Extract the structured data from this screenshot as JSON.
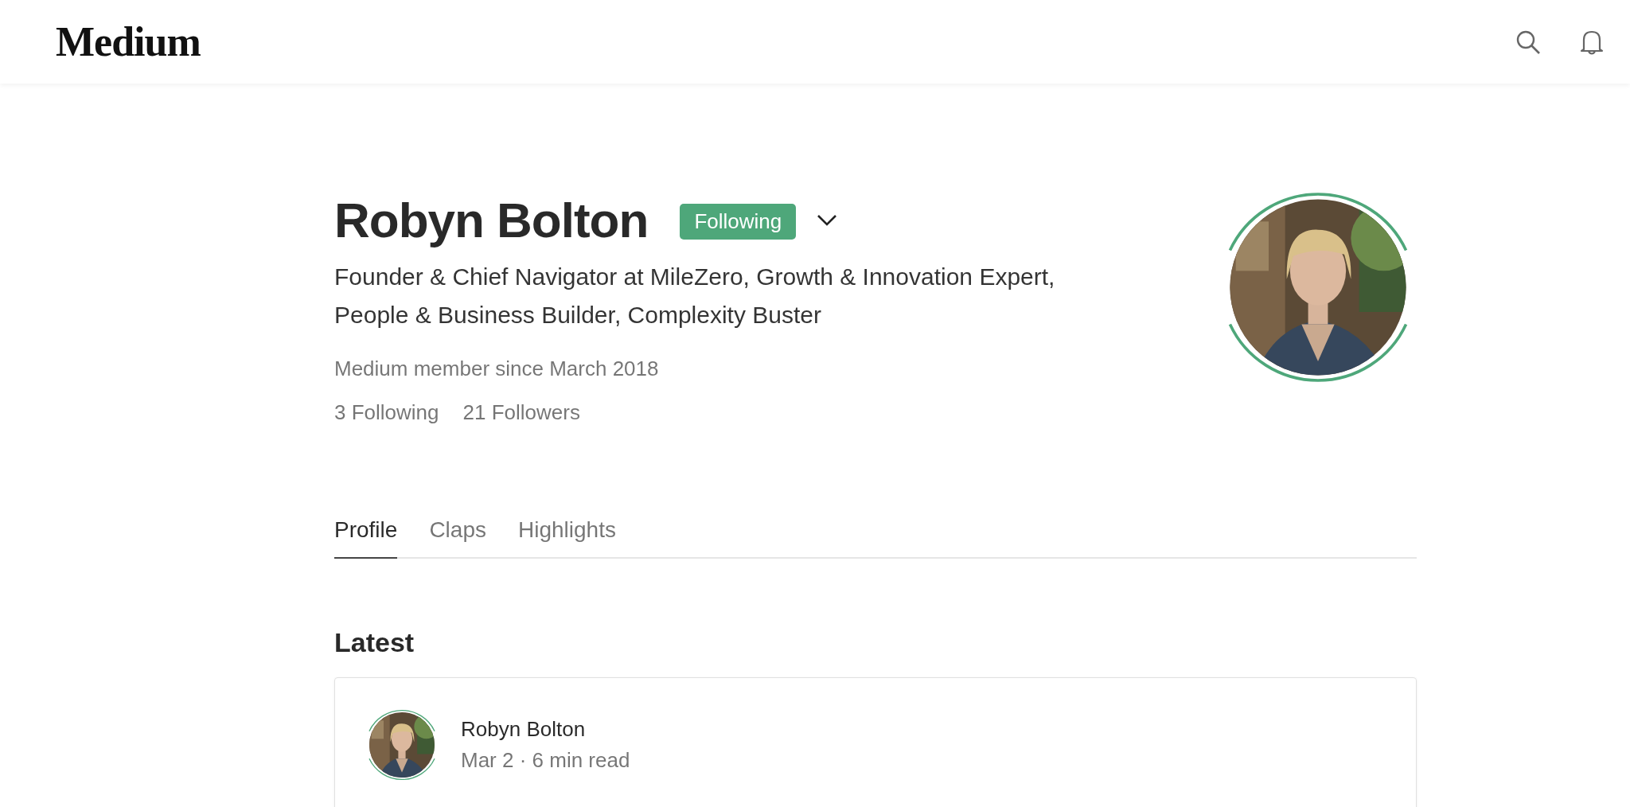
{
  "header": {
    "logo": "Medium"
  },
  "profile": {
    "name": "Robyn Bolton",
    "follow_button": "Following",
    "bio": "Founder & Chief Navigator at MileZero, Growth & Innovation Expert, People & Business Builder, Complexity Buster",
    "member_since": "Medium member since March 2018",
    "stats": [
      "3 Following",
      "21 Followers"
    ]
  },
  "tabs": [
    {
      "label": "Profile",
      "selected": true
    },
    {
      "label": "Claps",
      "selected": false
    },
    {
      "label": "Highlights",
      "selected": false
    }
  ],
  "section_title": "Latest",
  "posts": [
    {
      "author": "Robyn Bolton",
      "meta": "Mar 2 · 6 min read"
    }
  ]
}
